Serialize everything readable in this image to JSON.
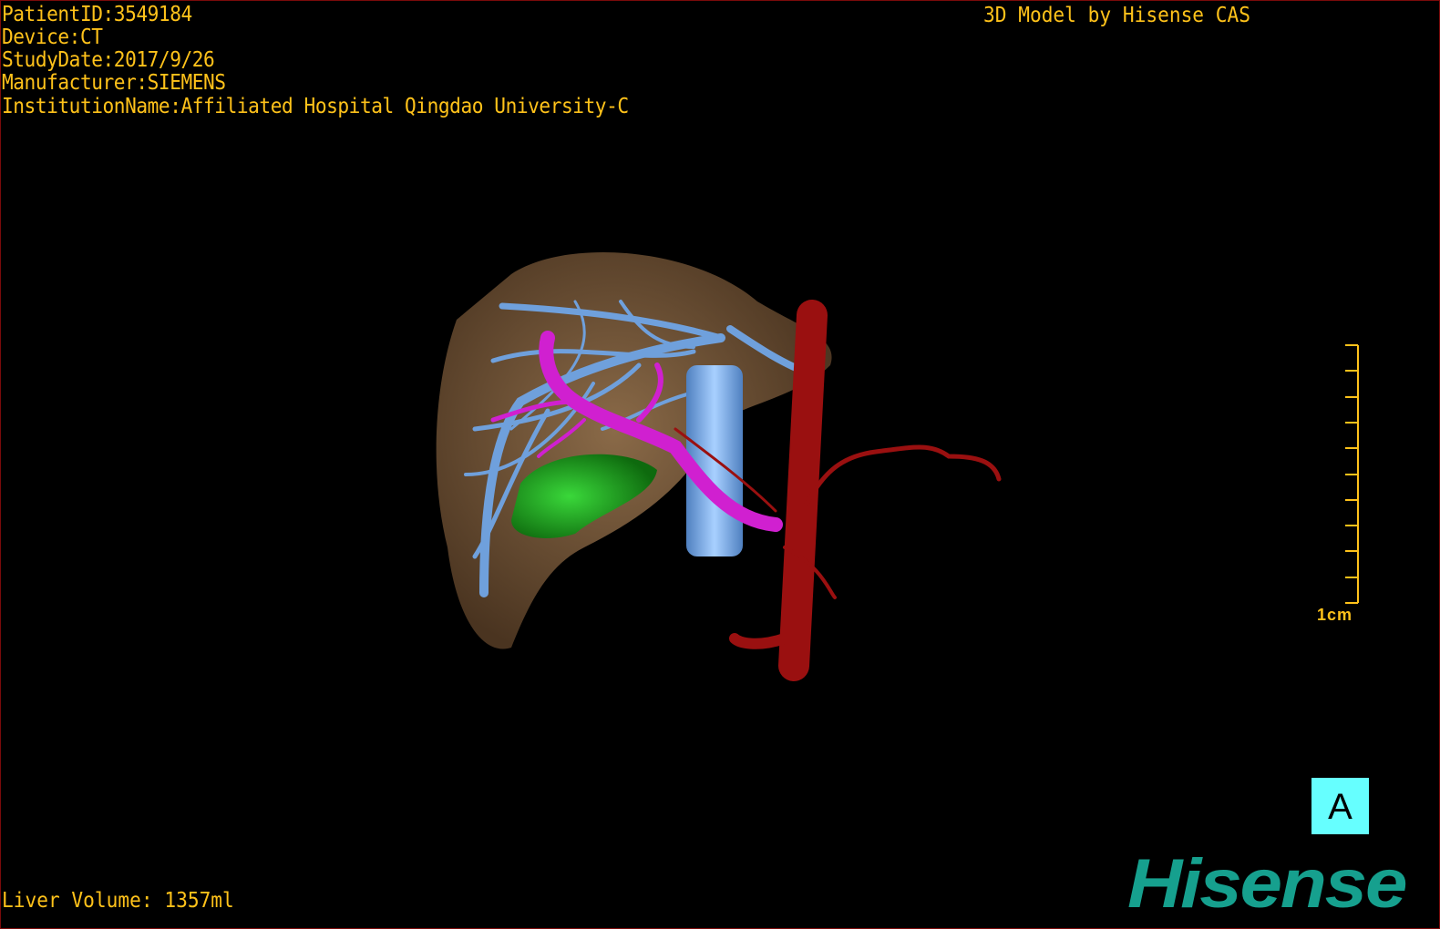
{
  "header": {
    "patient_id": "PatientID:3549184",
    "device": "Device:CT",
    "study_date": "StudyDate:2017/9/26",
    "manufacturer": "Manufacturer:SIEMENS",
    "institution": "InstitutionName:Affiliated Hospital Qingdao University-C",
    "credit": "3D Model by Hisense CAS"
  },
  "footer": {
    "liver_volume": "Liver Volume: 1357ml"
  },
  "scale_bar": {
    "label": "1cm"
  },
  "orientation": {
    "label": "A"
  },
  "logo": {
    "text": "Hisense"
  },
  "colors": {
    "text": "#ffc21a",
    "liver": "#7a5a3a",
    "hepatic_vein": "#6fa0dc",
    "portal_vein": "#d020d0",
    "gallbladder": "#1c9a1c",
    "ivc": "#7cb4f0",
    "artery": "#9a1010",
    "orientation_cube": "#66ffff",
    "logo": "#16a08e"
  }
}
